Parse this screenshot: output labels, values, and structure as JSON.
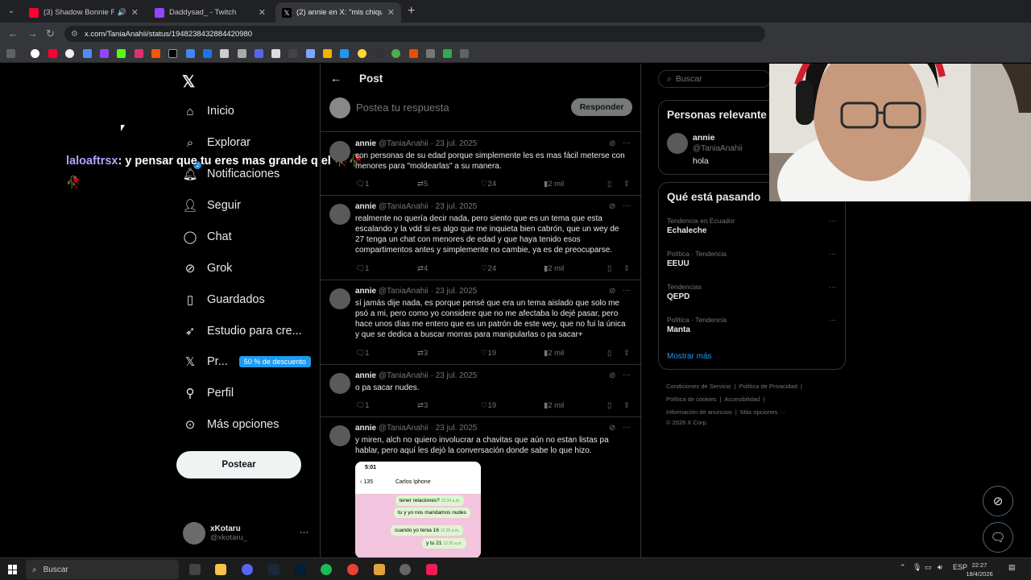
{
  "browser": {
    "tabs": [
      {
        "title": "(3) Shadow Bonnie Full Mu",
        "favicon_color": "#ff0033"
      },
      {
        "title": "Daddysad_ - Twitch",
        "favicon_color": "#9146ff"
      },
      {
        "title": "(2) annie en X: \"mis chiquillas q",
        "favicon_color": "#000000"
      }
    ],
    "url": "x.com/TaniaAnahii/status/1948238432884420980"
  },
  "sidebar": {
    "items": [
      {
        "label": "Inicio",
        "icon": "home-icon"
      },
      {
        "label": "Explorar",
        "icon": "search-icon"
      },
      {
        "label": "Notificaciones",
        "icon": "bell-icon",
        "badge": "2"
      },
      {
        "label": "Seguir",
        "icon": "add-user-icon"
      },
      {
        "label": "Chat",
        "icon": "chat-icon"
      },
      {
        "label": "Grok",
        "icon": "grok-icon"
      },
      {
        "label": "Guardados",
        "icon": "bookmark-icon"
      },
      {
        "label": "Estudio para cre...",
        "icon": "rocket-icon"
      },
      {
        "label": "Pr...",
        "icon": "x-logo-icon",
        "badge": "50 % de descuento"
      },
      {
        "label": "Perfil",
        "icon": "profile-icon"
      },
      {
        "label": "Más opciones",
        "icon": "more-icon"
      }
    ],
    "post_button": "Postear",
    "account": {
      "name": "xKotaru",
      "handle": "@xkotaru_"
    }
  },
  "overlay_chat": {
    "user": "laloaftrsx",
    "message": ": y pensar que tu eres mas grande q el 🥀🥀🥀"
  },
  "main": {
    "title": "Post",
    "reply_placeholder": "Postea tu respuesta",
    "reply_button": "Responder",
    "tweets": [
      {
        "name": "annie",
        "handle": "@TaniaAnahii",
        "date": "23 jul. 2025",
        "text": "con personas de su edad porque simplemente les es mas fácil meterse con menores para \"moldearlas\" a su manera.",
        "replies": "1",
        "reposts": "5",
        "likes": "24",
        "views": "2 mil"
      },
      {
        "name": "annie",
        "handle": "@TaniaAnahii",
        "date": "23 jul. 2025",
        "text": "realmente no quería decir nada, pero siento que es un tema que esta escalando y la vdd si es algo que me inquieta bien cabrón, que un wey de 27 tenga un chat con menores de edad y que haya tenido esos compartimentos antes y simplemente no cambie, ya es de preocuparse.",
        "replies": "1",
        "reposts": "4",
        "likes": "24",
        "views": "2 mil"
      },
      {
        "name": "annie",
        "handle": "@TaniaAnahii",
        "date": "23 jul. 2025",
        "text": "sí jamás dije nada, es porque pensé que era un tema aislado que solo me psó a mi, pero como yo considere que no me afectaba lo dejé pasar, pero hace unos días me entero que es un patrón de este wey, que no fui la única y que se dedica a buscar morras para manipularlas o pa sacar+",
        "replies": "1",
        "reposts": "3",
        "likes": "19",
        "views": "2 mil"
      },
      {
        "name": "annie",
        "handle": "@TaniaAnahii",
        "date": "23 jul. 2025",
        "text": "o pa sacar nudes.",
        "replies": "1",
        "reposts": "3",
        "likes": "19",
        "views": "2 mil"
      },
      {
        "name": "annie",
        "handle": "@TaniaAnahii",
        "date": "23 jul. 2025",
        "text": "y miren, alch no quiero involucrar a chavitas que aún no estan listas pa hablar, pero aquí les dejó la conversación donde sabe lo que hizo."
      }
    ],
    "media": {
      "time": "5:01",
      "count": "135",
      "contact": "Carlos Iphone",
      "bubbles": [
        "tener relaciones?",
        "tu y yo nos mandamos nudes",
        "cuando yo tenia 16",
        "y tu 21"
      ],
      "bubble_times": [
        "12:34 a.m.",
        "12:35 a.m.",
        "12:35 a.m.",
        "12:35 a.m."
      ]
    }
  },
  "right": {
    "search_placeholder": "Buscar",
    "relevant_title": "Personas relevante",
    "relevant": {
      "name": "annie",
      "handle": "@TaniaAnahii",
      "bio": "hola"
    },
    "trends_title": "Qué está pasando",
    "trends": [
      {
        "category": "Tendencia en Ecuador",
        "name": "Echaleche"
      },
      {
        "category": "Política · Tendencia",
        "name": "EEUU"
      },
      {
        "category": "Tendencias",
        "name": "QEPD"
      },
      {
        "category": "Política · Tendencia",
        "name": "Manta"
      }
    ],
    "show_more": "Mostrar más",
    "footer": [
      "Condiciones de Servicio",
      "Política de Privacidad",
      "Política de cookies",
      "Accesibilidad",
      "Información de anuncios",
      "Más opciones ···",
      "© 2026 X Corp."
    ]
  },
  "taskbar": {
    "search": "Buscar",
    "lang": "ESP",
    "time": "22:27",
    "date": "18/4/2026"
  },
  "colors": {
    "accent": "#1d9bf0",
    "background": "#000000",
    "border": "#2f3336",
    "muted": "#71767b"
  }
}
